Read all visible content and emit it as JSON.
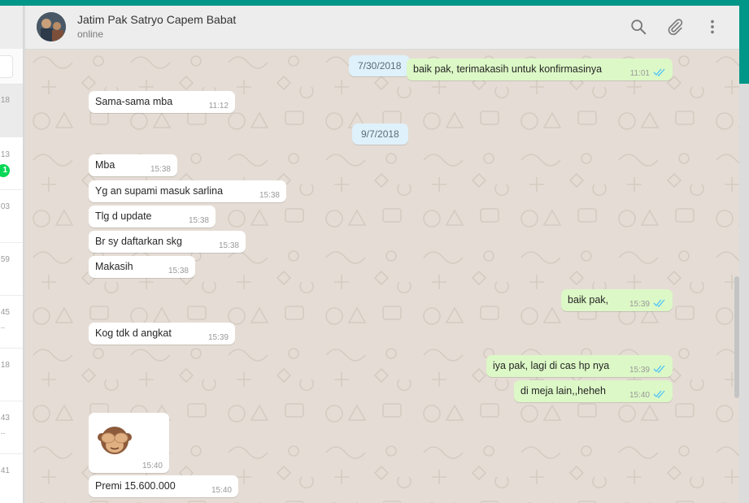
{
  "left_panel": {
    "times": [
      "18",
      "13",
      "03",
      "59",
      "45",
      "18",
      "43",
      "41"
    ],
    "unread_badge": "1",
    "ellipsis": "..."
  },
  "header": {
    "contact_name": "Jatim Pak Satryo Capem Babat",
    "status": "online",
    "icons": [
      "search-icon",
      "attach-icon",
      "menu-icon"
    ]
  },
  "messages": [
    {
      "type": "date",
      "text": "7/30/2018"
    },
    {
      "type": "out",
      "text": "baik pak, terimakasih untuk konfirmasinya",
      "time": "11:01"
    },
    {
      "type": "in",
      "text": "Sama-sama mba",
      "time": "11:12"
    },
    {
      "type": "date",
      "text": "9/7/2018"
    },
    {
      "type": "in",
      "text": "Mba",
      "time": "15:38"
    },
    {
      "type": "in",
      "text": "Yg an supami masuk sarlina",
      "time": "15:38"
    },
    {
      "type": "in",
      "text": "Tlg d update",
      "time": "15:38"
    },
    {
      "type": "in",
      "text": "Br sy daftarkan skg",
      "time": "15:38"
    },
    {
      "type": "in",
      "text": "Makasih",
      "time": "15:38"
    },
    {
      "type": "out",
      "text": "baik pak,",
      "time": "15:39"
    },
    {
      "type": "in",
      "text": "Kog tdk d angkat",
      "time": "15:39"
    },
    {
      "type": "out",
      "text": "iya pak, lagi di cas hp nya",
      "time": "15:39"
    },
    {
      "type": "out",
      "text": "di meja lain,,heheh",
      "time": "15:40"
    },
    {
      "type": "in-image",
      "emoji": "see-no-evil-monkey",
      "time": "15:40"
    },
    {
      "type": "in",
      "text": "Premi 15.600.000",
      "time": "15:40"
    }
  ],
  "colors": {
    "accent": "#009688",
    "outgoing_bubble": "#dcf8c6",
    "incoming_bubble": "#ffffff",
    "chat_background": "#e5ddd5",
    "date_pill": "#dff1fb",
    "read_ticks": "#4fc3f7"
  }
}
